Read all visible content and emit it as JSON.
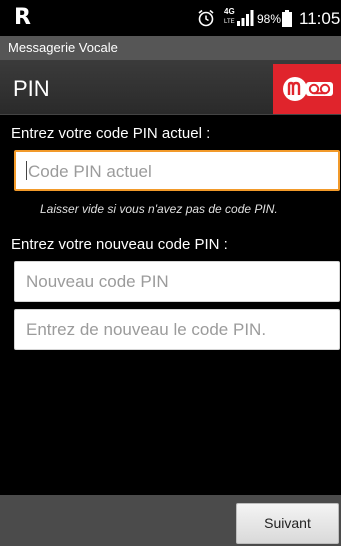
{
  "status_bar": {
    "carrier": "R",
    "network_type": "4G",
    "network_sub": "LTE",
    "battery_percent": "98%",
    "time": "11:05"
  },
  "app_bar": {
    "title": "Messagerie Vocale"
  },
  "section": {
    "title": "PIN",
    "logo_color": "#e0242c"
  },
  "form": {
    "current_pin_label": "Entrez votre code PIN actuel :",
    "current_pin_placeholder": "Code PIN actuel",
    "current_pin_hint": "Laisser vide si vous n'avez pas de code PIN.",
    "new_pin_label": "Entrez votre nouveau code PIN :",
    "new_pin_placeholder": "Nouveau code PIN",
    "confirm_pin_placeholder": "Entrez de nouveau le code PIN."
  },
  "bottom_bar": {
    "next_label": "Suivant"
  },
  "colors": {
    "accent_focus": "#f29a2a",
    "brand_red": "#e0242c"
  }
}
